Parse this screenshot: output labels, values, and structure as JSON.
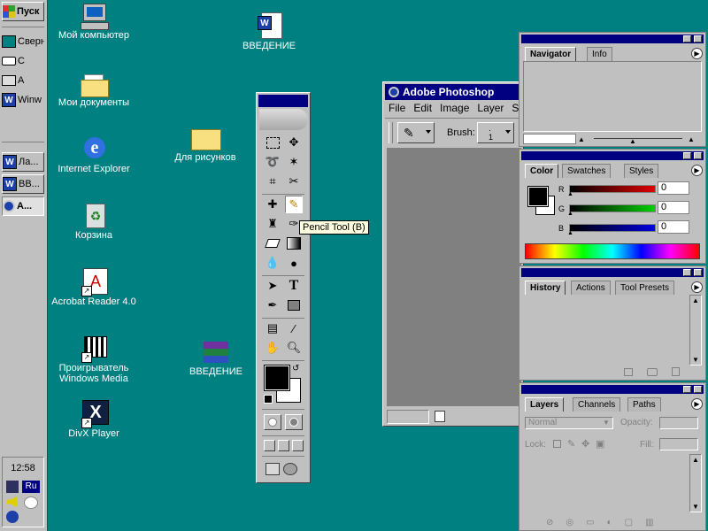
{
  "taskbar": {
    "start_label": "Пуск",
    "quick": [
      {
        "label": "Сверн"
      },
      {
        "label": "С"
      },
      {
        "label": "А"
      },
      {
        "label": "Winw"
      }
    ],
    "tasks": [
      {
        "label": "Ла..."
      },
      {
        "label": "ВВ..."
      },
      {
        "label": "А..."
      }
    ],
    "clock": "12:58",
    "lang": "Ru"
  },
  "desktop": {
    "icons": [
      {
        "label": "Мой компьютер"
      },
      {
        "label": "Мои документы"
      },
      {
        "label": "Internet Explorer"
      },
      {
        "label": "Корзина"
      },
      {
        "label": "Acrobat Reader 4.0"
      },
      {
        "label": "Проигрыватель"
      },
      {
        "label": "Windows Media"
      },
      {
        "label": "DivX Player"
      },
      {
        "label": "ВВЕДЕНИЕ"
      },
      {
        "label": "Для рисунков"
      },
      {
        "label": "ВВЕДЕНИЕ"
      }
    ]
  },
  "photoshop": {
    "title": "Adobe Photoshop",
    "menu": [
      "File",
      "Edit",
      "Image",
      "Layer",
      "S"
    ],
    "brush_label": "Brush:",
    "brush_value": "1",
    "tooltip": "Pencil Tool (B)"
  },
  "navigator": {
    "tabs": [
      "Navigator",
      "Info"
    ]
  },
  "color": {
    "tabs": [
      "Color",
      "Swatches",
      "Styles"
    ],
    "r": "0",
    "g": "0",
    "b": "0",
    "r_label": "R",
    "g_label": "G",
    "b_label": "B"
  },
  "history": {
    "tabs": [
      "History",
      "Actions",
      "Tool Presets"
    ]
  },
  "layers": {
    "tabs": [
      "Layers",
      "Channels",
      "Paths"
    ],
    "blend": "Normal",
    "opacity_label": "Opacity:",
    "lock_label": "Lock:",
    "fill_label": "Fill:"
  }
}
